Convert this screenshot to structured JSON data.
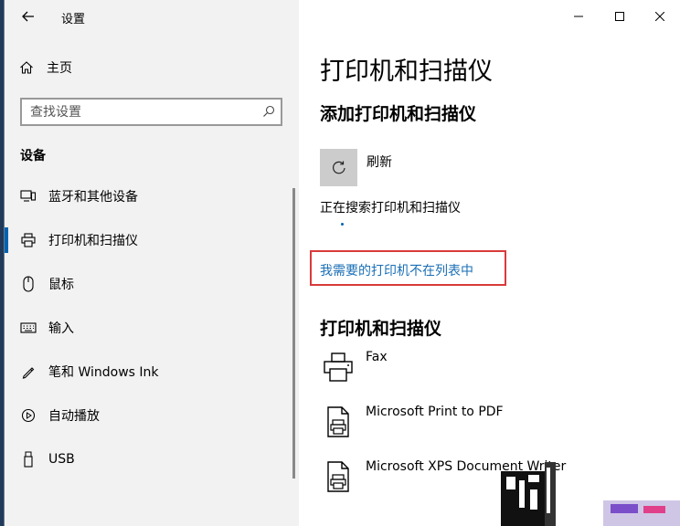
{
  "window": {
    "title": "设置",
    "controls": {
      "minimize": "minimize",
      "maximize": "maximize",
      "close": "close"
    }
  },
  "sidebar": {
    "home_label": "主页",
    "search": {
      "placeholder": "查找设置",
      "value": ""
    },
    "section_title": "设备",
    "items": [
      {
        "label": "蓝牙和其他设备",
        "icon": "bluetooth-devices-icon"
      },
      {
        "label": "打印机和扫描仪",
        "icon": "printer-icon",
        "active": true
      },
      {
        "label": "鼠标",
        "icon": "mouse-icon"
      },
      {
        "label": "输入",
        "icon": "keyboard-icon"
      },
      {
        "label": "笔和 Windows Ink",
        "icon": "pen-icon"
      },
      {
        "label": "自动播放",
        "icon": "autoplay-icon"
      },
      {
        "label": "USB",
        "icon": "usb-icon"
      }
    ]
  },
  "main": {
    "heading": "打印机和扫描仪",
    "add_heading": "添加打印机和扫描仪",
    "refresh_label": "刷新",
    "searching_text": "正在搜索打印机和扫描仪",
    "missing_printer_link": "我需要的打印机不在列表中",
    "printers_heading": "打印机和扫描仪",
    "printers": [
      {
        "name": "Fax",
        "icon": "fax-icon"
      },
      {
        "name": "Microsoft Print to PDF",
        "icon": "pdf-printer-icon"
      },
      {
        "name": "Microsoft XPS Document Writer",
        "icon": "xps-printer-icon"
      }
    ]
  },
  "colors": {
    "accent": "#0063b1",
    "link": "#1a6fb6",
    "highlight_box": "#d93a3a",
    "sidebar_bg": "#f2f2f2"
  }
}
